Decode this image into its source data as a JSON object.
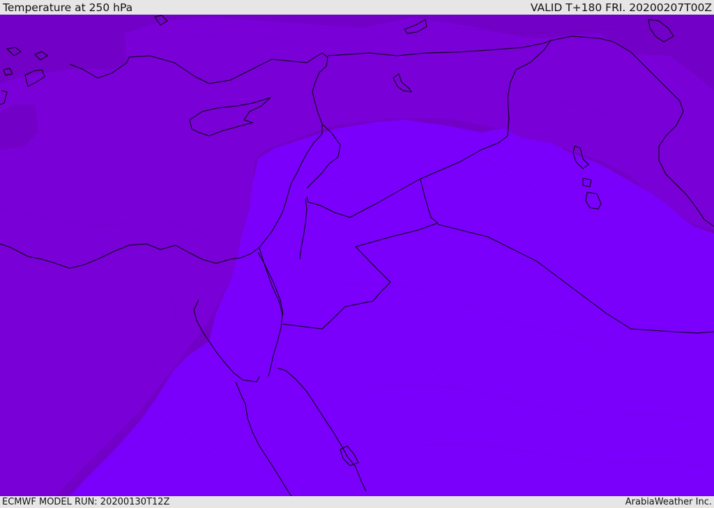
{
  "header": {
    "title": "Temperature at 250 hPa",
    "valid_time": "VALID T+180 FRI. 20200207T00Z"
  },
  "footer": {
    "model_run": "ECMWF MODEL RUN: 20200130T12Z",
    "credit": "ArabiaWeather Inc."
  },
  "map": {
    "colors": {
      "band_dark": "#7300c6",
      "band_mid": "#7a00d8",
      "band_light": "#7b00fb",
      "coastline": "#000000"
    }
  }
}
